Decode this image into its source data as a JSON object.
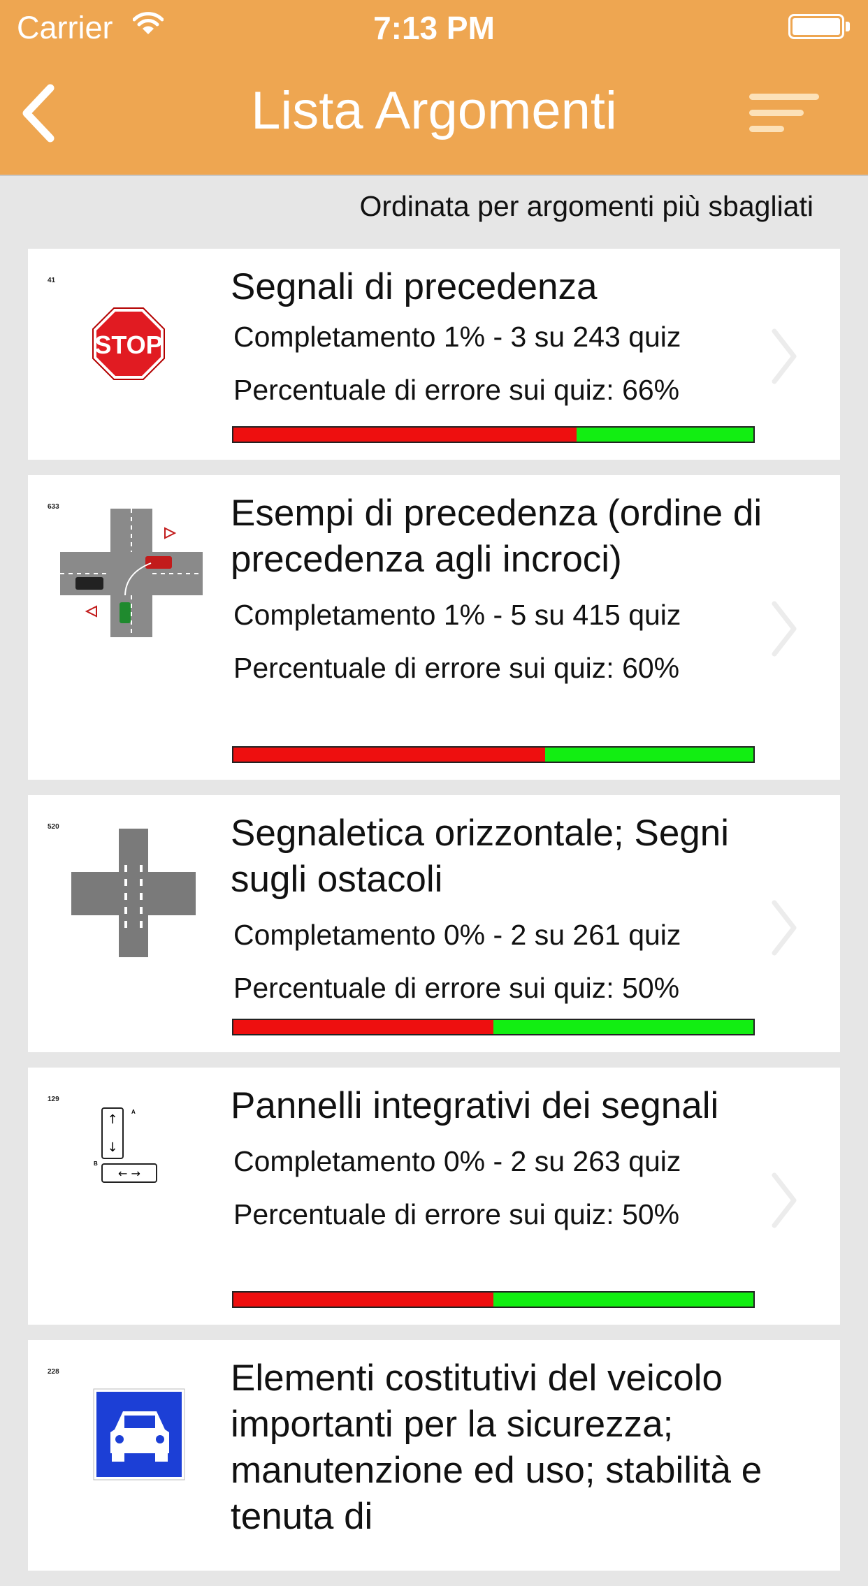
{
  "status_bar": {
    "carrier": "Carrier",
    "time": "7:13 PM"
  },
  "nav": {
    "title": "Lista Argomenti"
  },
  "sort_note": "Ordinata per argomenti più sbagliati",
  "topics": [
    {
      "thumb_number": "41",
      "icon": "stop-sign-icon",
      "title": "Segnali di precedenza",
      "completion": "Completamento 1% - 3 su 243 quiz",
      "error_text": "Percentuale di errore sui quiz: 66%",
      "error_fraction": 0.66
    },
    {
      "thumb_number": "633",
      "icon": "intersection-icon",
      "title": "Esempi di precedenza (ordine di precedenza agli incroci)",
      "completion": "Completamento 1% - 5 su 415 quiz",
      "error_text": "Percentuale di errore sui quiz: 60%",
      "error_fraction": 0.6
    },
    {
      "thumb_number": "520",
      "icon": "crosswalk-icon",
      "title": "Segnaletica orizzontale; Segni sugli ostacoli",
      "completion": "Completamento 0% - 2 su 261 quiz",
      "error_text": "Percentuale di errore sui quiz: 50%",
      "error_fraction": 0.5
    },
    {
      "thumb_number": "129",
      "icon": "direction-panel-icon",
      "title": "Pannelli integrativi dei segnali",
      "completion": "Completamento 0% - 2 su 263 quiz",
      "error_text": "Percentuale di errore sui quiz: 50%",
      "error_fraction": 0.5
    },
    {
      "thumb_number": "228",
      "icon": "car-sign-icon",
      "title": "Elementi costitutivi del veicolo importanti per la sicurezza; manutenzione ed uso; stabilità e tenuta di"
    }
  ],
  "colors": {
    "nav": "#eea651",
    "error_bar": "#ee0f0f",
    "ok_bar": "#12ee12"
  }
}
